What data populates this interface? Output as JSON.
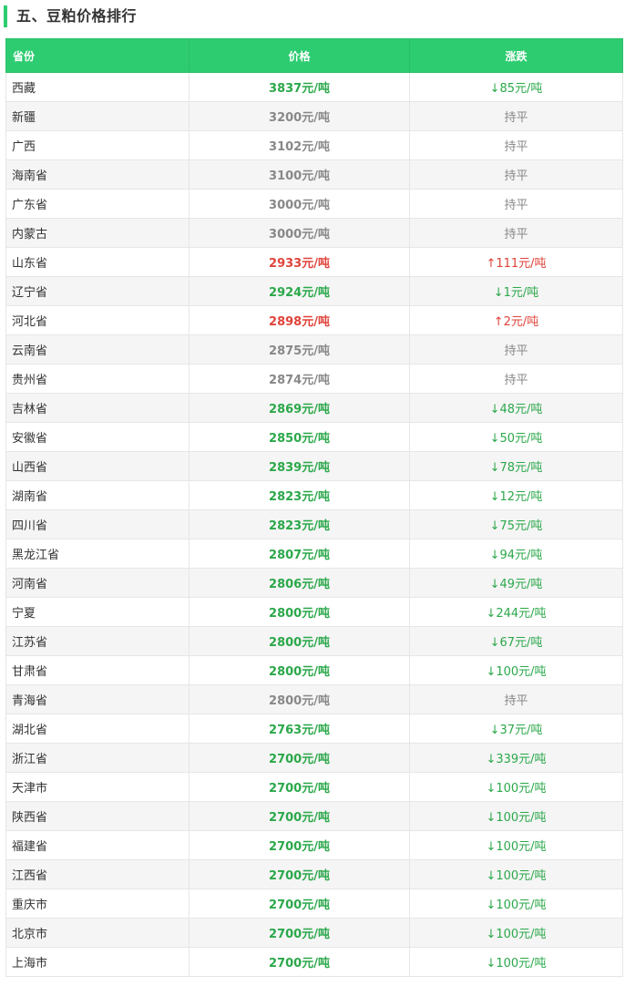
{
  "section": {
    "title": "五、豆粕价格排行"
  },
  "colors": {
    "accent": "#2ecc71",
    "down": "#2ba84a",
    "up": "#e0433a",
    "flat": "#888888"
  },
  "table": {
    "headers": [
      "省份",
      "价格",
      "涨跌"
    ],
    "rows": [
      {
        "province": "西藏",
        "price": "3837元/吨",
        "change": "↓85元/吨",
        "trend": "down"
      },
      {
        "province": "新疆",
        "price": "3200元/吨",
        "change": "持平",
        "trend": "flat"
      },
      {
        "province": "广西",
        "price": "3102元/吨",
        "change": "持平",
        "trend": "flat"
      },
      {
        "province": "海南省",
        "price": "3100元/吨",
        "change": "持平",
        "trend": "flat"
      },
      {
        "province": "广东省",
        "price": "3000元/吨",
        "change": "持平",
        "trend": "flat"
      },
      {
        "province": "内蒙古",
        "price": "3000元/吨",
        "change": "持平",
        "trend": "flat"
      },
      {
        "province": "山东省",
        "price": "2933元/吨",
        "change": "↑111元/吨",
        "trend": "up"
      },
      {
        "province": "辽宁省",
        "price": "2924元/吨",
        "change": "↓1元/吨",
        "trend": "down"
      },
      {
        "province": "河北省",
        "price": "2898元/吨",
        "change": "↑2元/吨",
        "trend": "up"
      },
      {
        "province": "云南省",
        "price": "2875元/吨",
        "change": "持平",
        "trend": "flat"
      },
      {
        "province": "贵州省",
        "price": "2874元/吨",
        "change": "持平",
        "trend": "flat"
      },
      {
        "province": "吉林省",
        "price": "2869元/吨",
        "change": "↓48元/吨",
        "trend": "down"
      },
      {
        "province": "安徽省",
        "price": "2850元/吨",
        "change": "↓50元/吨",
        "trend": "down"
      },
      {
        "province": "山西省",
        "price": "2839元/吨",
        "change": "↓78元/吨",
        "trend": "down"
      },
      {
        "province": "湖南省",
        "price": "2823元/吨",
        "change": "↓12元/吨",
        "trend": "down"
      },
      {
        "province": "四川省",
        "price": "2823元/吨",
        "change": "↓75元/吨",
        "trend": "down"
      },
      {
        "province": "黑龙江省",
        "price": "2807元/吨",
        "change": "↓94元/吨",
        "trend": "down"
      },
      {
        "province": "河南省",
        "price": "2806元/吨",
        "change": "↓49元/吨",
        "trend": "down"
      },
      {
        "province": "宁夏",
        "price": "2800元/吨",
        "change": "↓244元/吨",
        "trend": "down"
      },
      {
        "province": "江苏省",
        "price": "2800元/吨",
        "change": "↓67元/吨",
        "trend": "down"
      },
      {
        "province": "甘肃省",
        "price": "2800元/吨",
        "change": "↓100元/吨",
        "trend": "down"
      },
      {
        "province": "青海省",
        "price": "2800元/吨",
        "change": "持平",
        "trend": "flat"
      },
      {
        "province": "湖北省",
        "price": "2763元/吨",
        "change": "↓37元/吨",
        "trend": "down"
      },
      {
        "province": "浙江省",
        "price": "2700元/吨",
        "change": "↓339元/吨",
        "trend": "down"
      },
      {
        "province": "天津市",
        "price": "2700元/吨",
        "change": "↓100元/吨",
        "trend": "down"
      },
      {
        "province": "陕西省",
        "price": "2700元/吨",
        "change": "↓100元/吨",
        "trend": "down"
      },
      {
        "province": "福建省",
        "price": "2700元/吨",
        "change": "↓100元/吨",
        "trend": "down"
      },
      {
        "province": "江西省",
        "price": "2700元/吨",
        "change": "↓100元/吨",
        "trend": "down"
      },
      {
        "province": "重庆市",
        "price": "2700元/吨",
        "change": "↓100元/吨",
        "trend": "down"
      },
      {
        "province": "北京市",
        "price": "2700元/吨",
        "change": "↓100元/吨",
        "trend": "down"
      },
      {
        "province": "上海市",
        "price": "2700元/吨",
        "change": "↓100元/吨",
        "trend": "down"
      }
    ]
  }
}
